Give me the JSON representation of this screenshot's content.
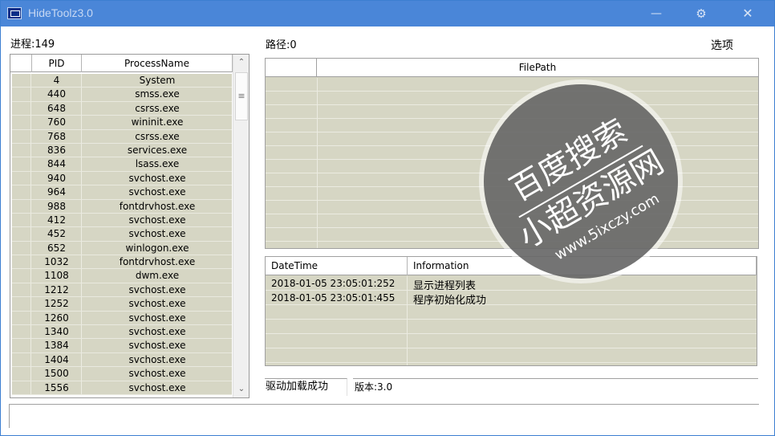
{
  "window": {
    "title": "HideToolz3.0",
    "minimize": "—",
    "settings": "⚙",
    "close": "✕"
  },
  "labels": {
    "process_count": "进程:149",
    "path_count": "路径:0",
    "options": "选项"
  },
  "process_table": {
    "columns": [
      "",
      "PID",
      "ProcessName"
    ],
    "rows": [
      [
        "4",
        "System"
      ],
      [
        "440",
        "smss.exe"
      ],
      [
        "648",
        "csrss.exe"
      ],
      [
        "760",
        "wininit.exe"
      ],
      [
        "768",
        "csrss.exe"
      ],
      [
        "836",
        "services.exe"
      ],
      [
        "844",
        "lsass.exe"
      ],
      [
        "940",
        "svchost.exe"
      ],
      [
        "964",
        "svchost.exe"
      ],
      [
        "988",
        "fontdrvhost.exe"
      ],
      [
        "412",
        "svchost.exe"
      ],
      [
        "452",
        "svchost.exe"
      ],
      [
        "652",
        "winlogon.exe"
      ],
      [
        "1032",
        "fontdrvhost.exe"
      ],
      [
        "1108",
        "dwm.exe"
      ],
      [
        "1212",
        "svchost.exe"
      ],
      [
        "1252",
        "svchost.exe"
      ],
      [
        "1260",
        "svchost.exe"
      ],
      [
        "1340",
        "svchost.exe"
      ],
      [
        "1384",
        "svchost.exe"
      ],
      [
        "1404",
        "svchost.exe"
      ],
      [
        "1500",
        "svchost.exe"
      ],
      [
        "1556",
        "svchost.exe"
      ]
    ]
  },
  "scroll": {
    "up": "⌃",
    "down": "⌄",
    "thumb": "≡"
  },
  "file_table": {
    "columns": [
      "",
      "FilePath"
    ]
  },
  "log_table": {
    "columns": [
      "DateTime",
      "Information"
    ],
    "rows": [
      [
        "2018-01-05 23:05:01:252",
        "显示进程列表"
      ],
      [
        "2018-01-05 23:05:01:455",
        "程序初始化成功"
      ]
    ]
  },
  "status": {
    "driver": "驱动加载成功",
    "version": "版本:3.0"
  },
  "watermark": {
    "line1": "百度搜索",
    "line2": "小超资源网",
    "line3": "www.5ixczy.com"
  }
}
